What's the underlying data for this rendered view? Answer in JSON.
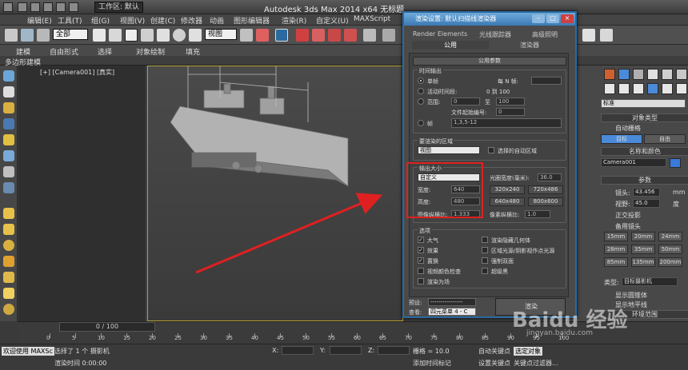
{
  "window": {
    "app_title": "Autodesk 3ds Max  2014 x64    无标题",
    "workspace_label": "工作区: 默认"
  },
  "menu": [
    "编辑(E)",
    "工具(T)",
    "组(G)",
    "视图(V)",
    "创建(C)",
    "修改器",
    "动画",
    "图形编辑器",
    "渲染(R)",
    "自定义(U)",
    "MAXScript"
  ],
  "toolbar": {
    "selection_filter": "全部",
    "ref_coord": "视图"
  },
  "ribbon": {
    "tabs": [
      "建模",
      "自由形式",
      "选择",
      "对象绘制",
      "填充"
    ],
    "sub": "多边形建模"
  },
  "viewport": {
    "label": "[+] [Camera001] [真实]"
  },
  "dialog": {
    "title": "渲染设置: 默认扫描线渲染器",
    "tabs_row1": [
      "Render Elements",
      "光线跟踪器",
      "高级照明"
    ],
    "tabs_row2": [
      "公用",
      "渲染器"
    ],
    "rollout_title": "公用参数",
    "time_output": {
      "label": "时间输出",
      "single": "单帧",
      "every_n": "每 N 帧:",
      "active_segment": "活动时间段:",
      "active_range": "0 到 100",
      "range": "范围:",
      "range_from": "0",
      "range_to_label": "至",
      "range_to": "100",
      "file_num_base": "文件起始编号:",
      "file_num_val": "0",
      "frames": "帧",
      "frames_val": "1,3,5-12"
    },
    "area": {
      "label": "要渲染的区域",
      "value": "视图",
      "auto_region": "选择的自动区域"
    },
    "output_size": {
      "label": "输出大小",
      "preset": "自定义",
      "aperture_label": "光圈宽度(毫米):",
      "aperture_val": "36.0",
      "width_label": "宽度:",
      "width_val": "640",
      "height_label": "高度:",
      "height_val": "480",
      "presets": [
        "320x240",
        "720x486",
        "640x480",
        "800x600"
      ],
      "image_aspect_label": "图像纵横比:",
      "image_aspect_val": "1.333",
      "pixel_aspect_label": "像素纵横比:",
      "pixel_aspect_val": "1.0"
    },
    "options": {
      "label": "选项",
      "items_left": [
        {
          "label": "大气",
          "checked": true
        },
        {
          "label": "效果",
          "checked": true
        },
        {
          "label": "置换",
          "checked": true
        },
        {
          "label": "视频颜色检查",
          "checked": false
        },
        {
          "label": "渲染为场",
          "checked": false
        }
      ],
      "items_right": [
        {
          "label": "渲染隐藏几何体",
          "checked": false
        },
        {
          "label": "区域光源/阴影视作点光源",
          "checked": false
        },
        {
          "label": "强制双面",
          "checked": false
        },
        {
          "label": "超级黑",
          "checked": false
        }
      ]
    },
    "footer": {
      "preset_label": "预设:",
      "preset_val": "----------------",
      "view_label": "查看:",
      "view_val": "四元菜单 4 - C",
      "render_button": "渲染"
    }
  },
  "command_panel": {
    "dropdown": "标准",
    "object_type": "对象类型",
    "auto_grid": "自动栅格",
    "btn_target": "目标",
    "btn_free": "自由",
    "name_color": "名称和颜色",
    "name_val": "Camera001",
    "params": "参数",
    "lens_label": "镜头:",
    "lens_val": "43.456",
    "lens_unit": "mm",
    "fov_label": "视野:",
    "fov_val": "45.0",
    "fov_unit": "度",
    "ortho": "正交投影",
    "stock_lens": "备用镜头",
    "lenses": [
      "15mm",
      "20mm",
      "24mm",
      "28mm",
      "35mm",
      "50mm",
      "85mm",
      "135mm",
      "200mm"
    ],
    "type_label": "类型:",
    "type_val": "目标摄影机",
    "show_cone": "显示圆锥体",
    "show_horizon": "显示地平线",
    "env_range": "环境范围"
  },
  "timeline": {
    "slider": "0 / 100",
    "ticks": [
      "0",
      "5",
      "10",
      "15",
      "20",
      "25",
      "30",
      "35",
      "40",
      "45",
      "50",
      "55",
      "60",
      "65",
      "70",
      "75",
      "80",
      "85",
      "90",
      "95",
      "100"
    ]
  },
  "status": {
    "welcome": "欢迎使用 MAXSc",
    "selected": "选择了 1 个 摄影机",
    "render_time": "渲染时间 0:00:00",
    "x_label": "X:",
    "y_label": "Y:",
    "z_label": "Z:",
    "grid": "栅格 = 10.0",
    "add_time_tag": "添加时间标记",
    "auto_key": "自动关键点",
    "selected_obj": "选定对象",
    "set_key": "设置关键点",
    "key_filter": "关键点过滤器..."
  },
  "watermark": {
    "brand": "Baidu 经验",
    "url": "jingyan.baidu.com"
  },
  "colors": {
    "accent_blue": "#2a6aa0",
    "highlight_red": "#e02020",
    "viewport_border": "#b5a23a"
  }
}
